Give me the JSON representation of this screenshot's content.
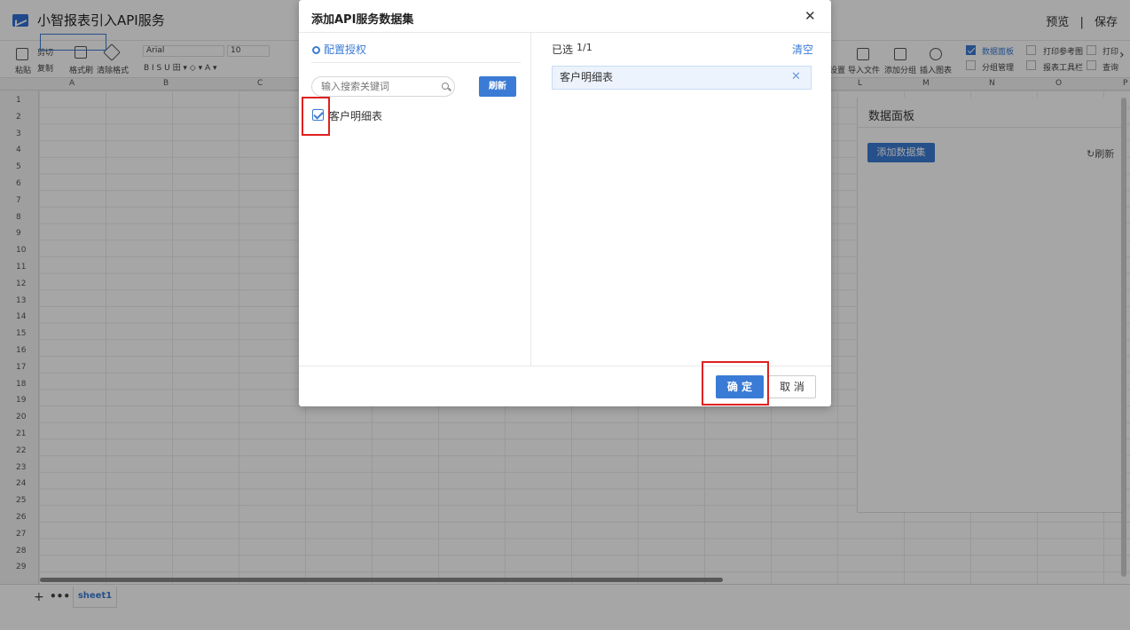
{
  "app": {
    "title": "小智报表引入API服务",
    "preview": "预览",
    "sep": "|",
    "save": "保存"
  },
  "toolbar": {
    "paste": "粘贴",
    "cut": "剪切",
    "copy": "复制",
    "format_painter": "格式刷",
    "clear_format": "清除格式",
    "font_name": "Arial",
    "font_size": "10",
    "font_style": "B  I  S  U  田 ▾ ◇ ▾ A ▾",
    "right_group": {
      "settings": "设置",
      "import_file": "导入文件",
      "add_group": "添加分组",
      "insert_chart": "插入图表"
    },
    "checks": [
      {
        "label": "数据面板",
        "checked": true
      },
      {
        "label": "打印参考图",
        "checked": false
      },
      {
        "label": "打印",
        "checked": false
      },
      {
        "label": "分组管理",
        "checked": false
      },
      {
        "label": "报表工具栏",
        "checked": false
      },
      {
        "label": "查询",
        "checked": false
      }
    ]
  },
  "sheet": {
    "columns": [
      "A",
      "B",
      "C",
      "L",
      "M",
      "N",
      "O",
      "P"
    ],
    "rows": [
      "1",
      "2",
      "3",
      "4",
      "5",
      "6",
      "7",
      "8",
      "9",
      "10",
      "11",
      "12",
      "13",
      "14",
      "15",
      "16",
      "17",
      "18",
      "19",
      "20",
      "21",
      "22",
      "23",
      "24",
      "25",
      "26",
      "27",
      "28",
      "29"
    ],
    "tab_add": "+",
    "tab_more": "•••",
    "tab_name": "sheet1"
  },
  "data_panel": {
    "title": "数据面板",
    "add_button": "添加数据集",
    "refresh": "↻刷新"
  },
  "dialog": {
    "title": "添加API服务数据集",
    "close": "✕",
    "config_auth": "配置授权",
    "search_placeholder": "输入搜索关键词",
    "refresh_button": "刷新",
    "items": [
      {
        "label": "客户明细表",
        "checked": true
      }
    ],
    "selected_label": "已选",
    "selected_count": "1/1",
    "clear": "清空",
    "selected_items": [
      "客户明细表"
    ],
    "selected_remove": "✕",
    "ok": "确 定",
    "cancel": "取 消"
  }
}
